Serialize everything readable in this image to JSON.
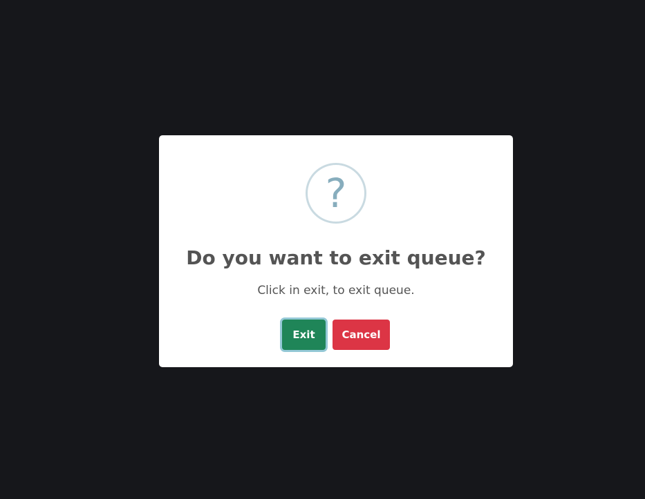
{
  "dialog": {
    "icon": "question-icon",
    "icon_glyph": "?",
    "title": "Do you want to exit queue?",
    "message": "Click in exit, to exit queue.",
    "confirm_label": "Exit",
    "cancel_label": "Cancel"
  },
  "colors": {
    "backdrop": "#16171b",
    "confirm": "#1f8558",
    "cancel": "#dc3545",
    "icon_ring": "#c9dae1",
    "icon_glyph": "#87adbd",
    "text": "#545454"
  }
}
